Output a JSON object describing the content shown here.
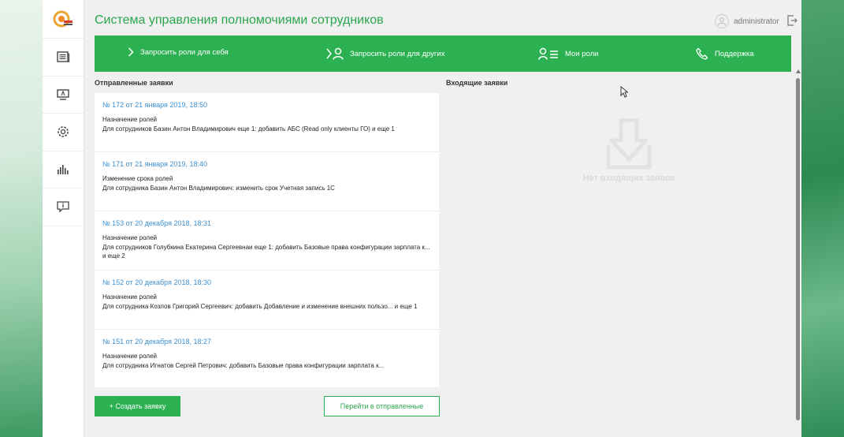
{
  "header": {
    "title": "Система управления полномочиями сотрудников",
    "username": "administrator"
  },
  "nav": {
    "items": [
      {
        "icon": "requests-icon"
      },
      {
        "icon": "monitor-icon"
      },
      {
        "icon": "gear-icon"
      },
      {
        "icon": "bar-chart-icon"
      },
      {
        "icon": "info-message-icon"
      }
    ]
  },
  "actions": {
    "request_self": "Запросить роли для себя",
    "request_others": "Запросить роли для других",
    "my_roles": "Мои роли",
    "support": "Поддержка"
  },
  "sent": {
    "title": "Отправленные заявки",
    "requests": [
      {
        "number": "№ 172 от 21 января 2019, 18:50",
        "type": "Назначение ролей",
        "description": "Для сотрудников Базин Антон Владимирович еще 1: добавить АБС (Read only клиенты ГО) и еще 1"
      },
      {
        "number": "№ 171 от 21 января 2019, 18:40",
        "type": "Изменение срока ролей",
        "description": "Для сотрудника Базин Антон Владимирович: изменить срок Учетная запись 1С"
      },
      {
        "number": "№ 153 от 20 декабря 2018, 18:31",
        "type": "Назначение ролей",
        "description": "Для сотрудников Голубкина Екатерина Сергеевнаи еще 1: добавить Базовые права конфигурации зарплата к... и еще 2"
      },
      {
        "number": "№ 152 от 20 декабря 2018, 18:30",
        "type": "Назначение ролей",
        "description": "Для сотрудника Козлов Григорий Сергеевич: добавить Добавление и изменение внешних пользо... и еще 1"
      },
      {
        "number": "№ 151 от 20 декабря 2018, 18:27",
        "type": "Назначение ролей",
        "description": "Для сотрудника Игнатов Сергей Петрович: добавить Базовые права конфигурации зарплата к..."
      }
    ],
    "create_button": "+ Создать заявку",
    "goto_button": "Перейти в отправленные"
  },
  "incoming": {
    "title": "Входящие заявки",
    "empty_text": "Нет входящих заявок"
  },
  "colors": {
    "accent": "#2cb152",
    "title_green": "#2aa64c",
    "link_blue": "#3b8fd0"
  }
}
